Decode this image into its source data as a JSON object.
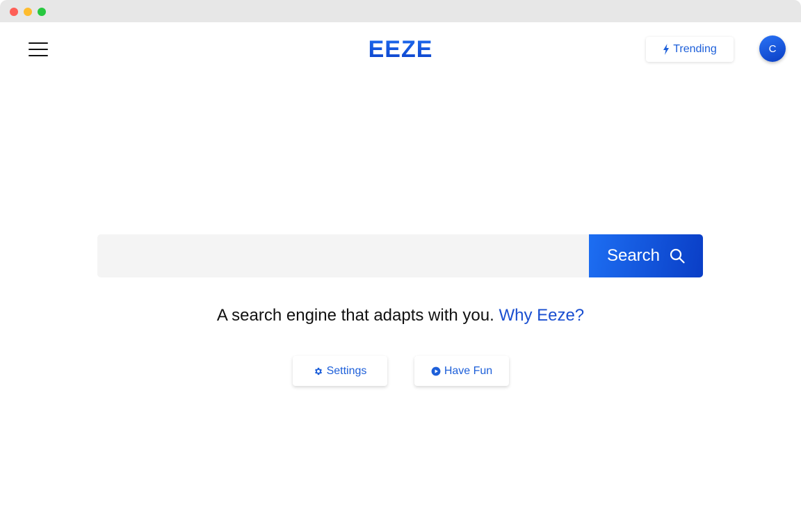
{
  "window": {
    "controls": [
      "close",
      "minimize",
      "maximize"
    ]
  },
  "header": {
    "menu_icon": "hamburger-menu-icon",
    "logo_text": "EEZE",
    "trending_label": "Trending",
    "trending_icon": "lightning-bolt-icon",
    "avatar_initial": "C"
  },
  "search": {
    "input_value": "",
    "button_label": "Search",
    "button_icon": "search-icon"
  },
  "tagline": {
    "text": "A search engine that adapts with you.",
    "link_text": "Why Eeze?"
  },
  "actions": {
    "settings_label": "Settings",
    "settings_icon": "gear-icon",
    "fun_label": "Have Fun",
    "fun_icon": "play-circle-icon"
  },
  "colors": {
    "brand_blue": "#1a5fe6",
    "brand_blue_dark": "#0a3ec6",
    "search_bg": "#f4f4f4",
    "traffic_close": "#fe5f57",
    "traffic_min": "#febc2e",
    "traffic_max": "#28c840"
  }
}
